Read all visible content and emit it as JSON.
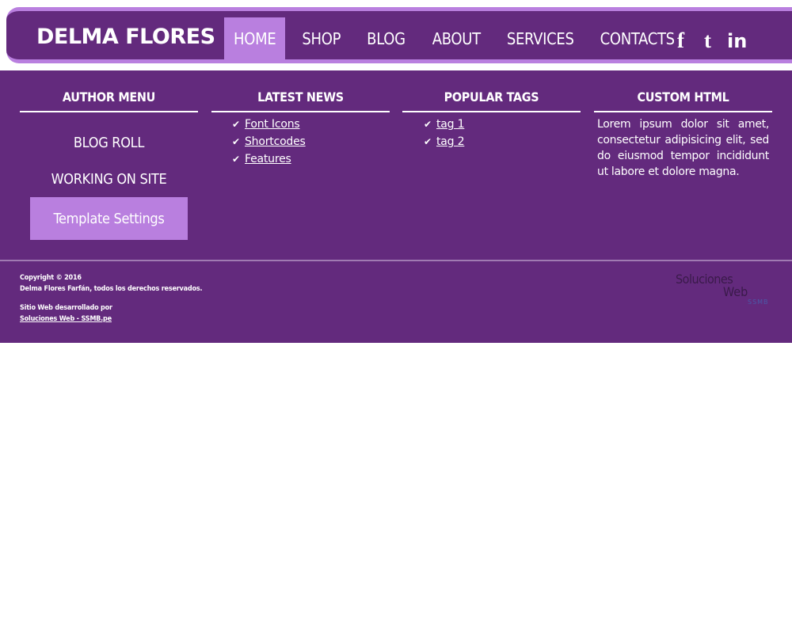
{
  "header": {
    "logo": "DELMA FLORES",
    "nav": [
      {
        "label": "HOME",
        "active": true
      },
      {
        "label": "SHOP"
      },
      {
        "label": "BLOG"
      },
      {
        "label": "ABOUT"
      },
      {
        "label": "SERVICES"
      },
      {
        "label": "CONTACTS"
      }
    ],
    "social": [
      {
        "icon": "facebook-icon",
        "glyph": "f"
      },
      {
        "icon": "tumblr-icon",
        "glyph": "t"
      },
      {
        "icon": "linkedin-icon",
        "glyph": "in"
      }
    ]
  },
  "author_menu": {
    "title": "AUTHOR MENU",
    "links": [
      "BLOG ROLL",
      "WORKING ON SITE"
    ],
    "button": "Template Settings"
  },
  "latest_news": {
    "title": "LATEST NEWS",
    "items": [
      "Font Icons",
      "Shortcodes",
      "Features"
    ]
  },
  "popular_tags": {
    "title": "POPULAR TAGS",
    "items": [
      "tag 1",
      "tag 2"
    ]
  },
  "custom_html": {
    "title": "CUSTOM HTML",
    "text": "Lorem ipsum dolor sit amet, consectetur adipisicing elit, sed do eiusmod tempor incididunt ut labore et dolore magna."
  },
  "footer": {
    "copyright_line1": "Copyright © 2016",
    "copyright_line2": "Delma Flores Farfán, todos los derechos reservados.",
    "developed_by": "Sitio Web desarrollado por",
    "developer_link": "Soluciones Web - SSMB.pe",
    "brand_line1": "Soluciones",
    "brand_line2": "Web",
    "brand_line3": "SSMB"
  },
  "colors": {
    "primary": "#632a7d",
    "accent": "#b97fdf",
    "text": "#ffffff"
  }
}
